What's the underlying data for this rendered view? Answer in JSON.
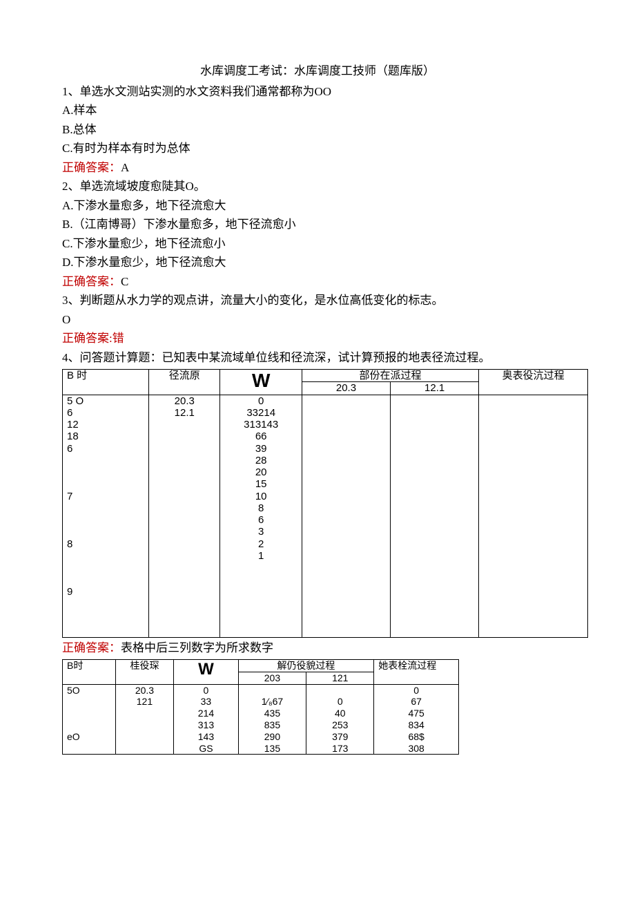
{
  "title": "水库调度工考试：水库调度工技师（题库版）",
  "q1": {
    "stem": "1、单选水文测站实测的水文资料我们通常都称为OO",
    "a": "A.样本",
    "b": "B.总体",
    "c": "C.有时为样本有时为总体",
    "ans_label": "正确答案：",
    "ans": "A"
  },
  "q2": {
    "stem": "2、单选流域坡度愈陡其O。",
    "a": "A.下渗水量愈多，地下径流愈大",
    "b": "B.（江南博哥）下渗水量愈多，地下径流愈小",
    "c": "C.下渗水量愈少，地下径流愈小",
    "d": "D.下渗水量愈少，地下径流愈大",
    "ans_label": "正确答案：",
    "ans": "C"
  },
  "q3": {
    "stem": "3、判断题从水力学的观点讲，流量大小的变化，是水位高低变化的标志。",
    "blank": "  O",
    "ans_label": "正确答案:",
    "ans": "错"
  },
  "q4": {
    "stem": "4、问答题计算题：已知表中某流域单位线和径流深，试计算预报的地表径流过程。",
    "table1": {
      "h_b": "B   时",
      "h_r": "径流原",
      "h_w": "W",
      "h_p": "部份在派过程",
      "h_p1": "20.3",
      "h_p2": "12.1",
      "h_ao": "奥表役沆过程",
      "col_b": "5      O\n         6\n       12\n       18\n6\n\n\n\n7\n\n\n\n8\n\n\n\n9",
      "col_r": "20.3\n12.1",
      "col_w": "0\n33214\n313143\n66\n39\n28\n20\n15\n10\n8\n  6\n3\n2\n  1"
    },
    "ans_label": "正确答案：",
    "ans_text": "表格中后三列数字为所求数字",
    "table2": {
      "h_b": "B时",
      "h_g": "桂役琛",
      "h_w": "W",
      "h_p": "解仍役貌过程",
      "h_p1": "203",
      "h_p2": "121",
      "h_ta": "她表栓流过程",
      "col_b": "5O\n\n\n\neO",
      "col_g": "20.3\n121",
      "col_w": "0\n33\n214\n313\n143\nGS",
      "col_p1": "\n1⁄₈67\n435\n835\n290\n135",
      "col_p2": "\n0\n40\n253\n379\n173",
      "col_ta": "0\n67\n475\n834\n68$\n308"
    }
  }
}
